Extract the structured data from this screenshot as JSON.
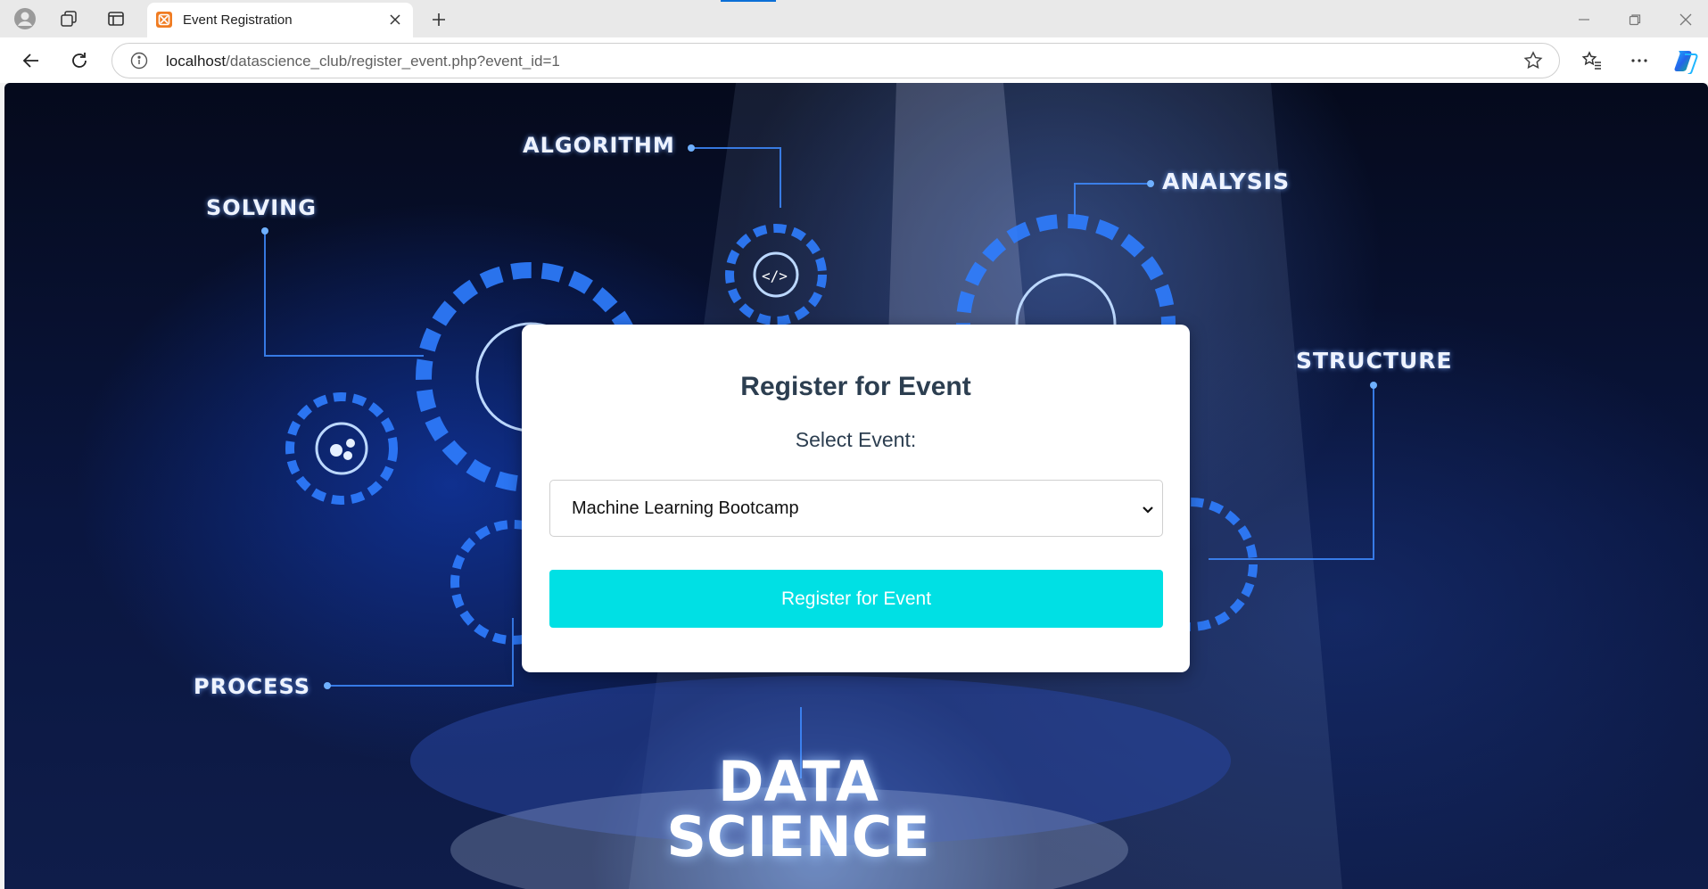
{
  "browser": {
    "tab": {
      "title": "Event Registration",
      "favicon": "xampp-icon"
    },
    "address": {
      "host": "localhost",
      "path": "/datascience_club/register_event.php?event_id=1"
    }
  },
  "background": {
    "labels": {
      "algorithm": "ALGORITHM",
      "solving": "SOLVING",
      "analysis": "ANALYSIS",
      "structure": "STRUCTURE",
      "process": "PROCESS",
      "data": "DATA",
      "science": "SCIENCE"
    }
  },
  "form": {
    "heading": "Register for Event",
    "select_label": "Select Event:",
    "selected_event": "Machine Learning Bootcamp",
    "submit_label": "Register for Event"
  },
  "colors": {
    "accent_button": "#00e0e4",
    "heading_text": "#2c3e50"
  }
}
